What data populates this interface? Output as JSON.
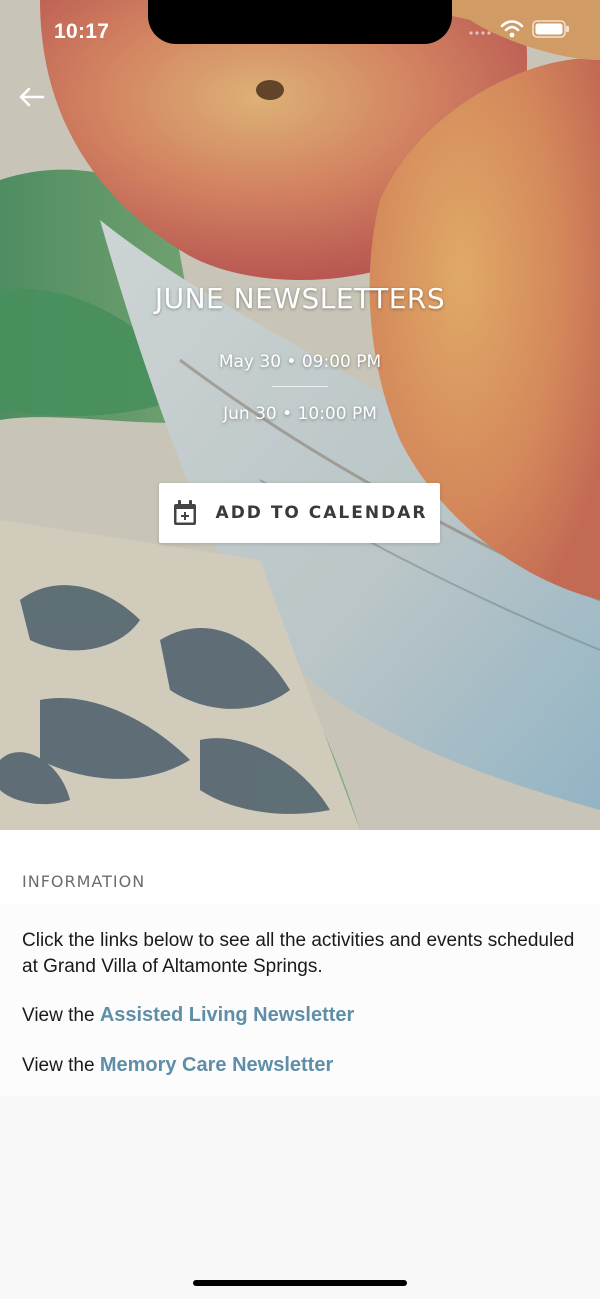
{
  "status_bar": {
    "time": "10:17"
  },
  "event": {
    "title": "JUNE NEWSLETTERS",
    "start": "May 30 • 09:00 PM",
    "end": "Jun 30 • 10:00 PM",
    "calendar_button_label": "ADD TO CALENDAR"
  },
  "information": {
    "header": "INFORMATION",
    "description": "Click the links below to see all the activities and events scheduled at Grand Villa of Altamonte Springs.",
    "links": [
      {
        "prefix": "View the ",
        "label": "Assisted Living Newsletter"
      },
      {
        "prefix": "View the ",
        "label": "Memory Care Newsletter"
      }
    ]
  },
  "colors": {
    "link": "#5f8ea8",
    "button_background": "#ffffff",
    "text": "#1a1a1a"
  },
  "icons": [
    "back-arrow-icon",
    "wifi-icon",
    "battery-icon",
    "signal-icon",
    "calendar-add-icon"
  ]
}
